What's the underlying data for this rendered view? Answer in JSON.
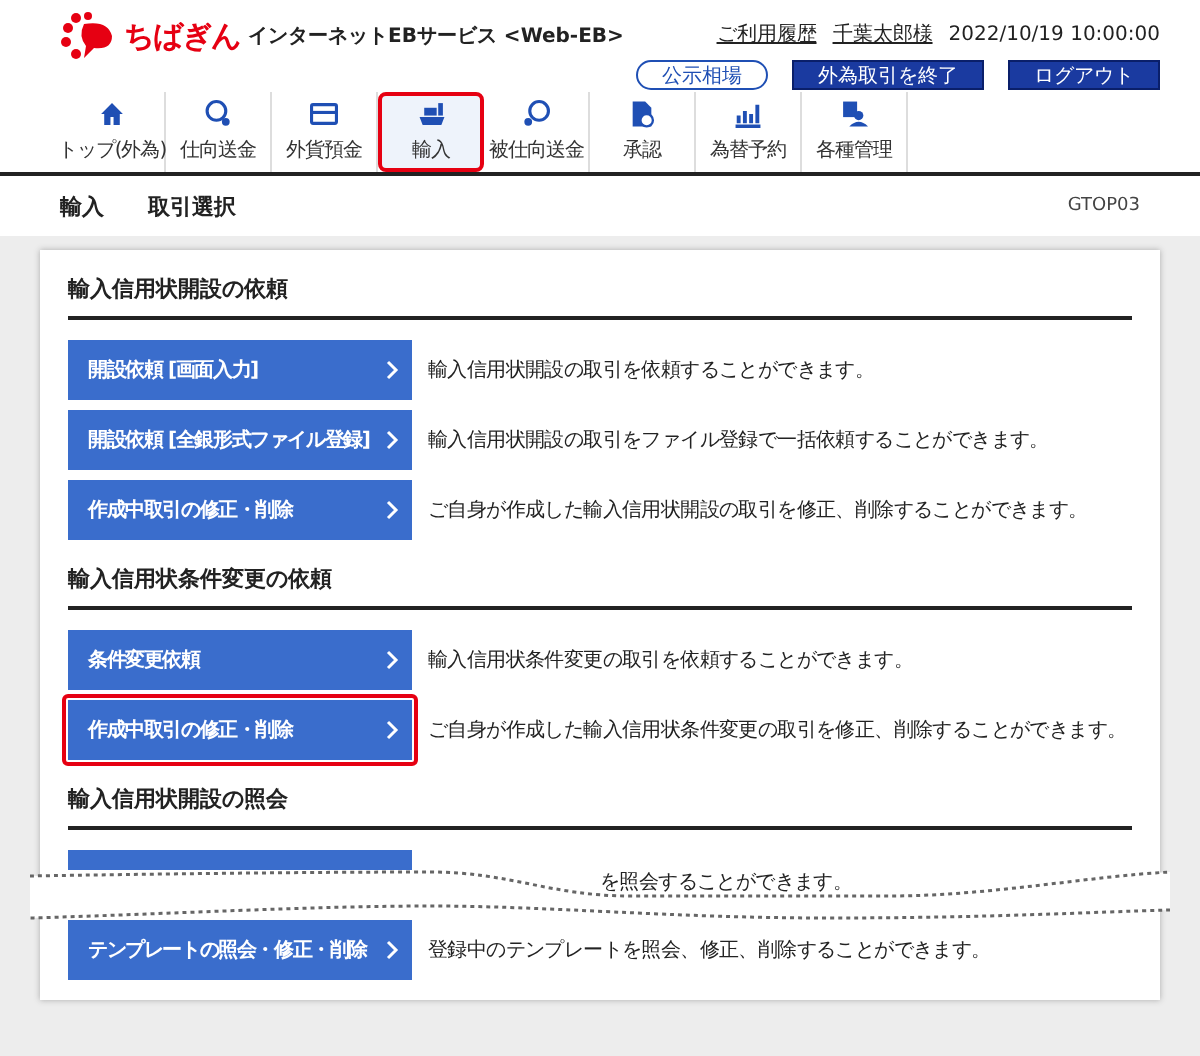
{
  "header": {
    "brand": "ちばぎん",
    "service": "インターネットEBサービス <Web-EB>",
    "links": [
      "ご利用履歴",
      "千葉太郎様"
    ],
    "timestamp": "2022/10/19 10:00:00",
    "buttons": [
      {
        "label": "公示相場",
        "kind": "outline"
      },
      {
        "label": "外為取引を終了",
        "kind": "solid"
      },
      {
        "label": "ログアウト",
        "kind": "solid"
      }
    ]
  },
  "nav": [
    {
      "label": "トップ(外為)",
      "selected": false
    },
    {
      "label": "仕向送金",
      "selected": false
    },
    {
      "label": "外貨預金",
      "selected": false
    },
    {
      "label": "輸入",
      "selected": true
    },
    {
      "label": "被仕向送金",
      "selected": false
    },
    {
      "label": "承認",
      "selected": false
    },
    {
      "label": "為替予約",
      "selected": false
    },
    {
      "label": "各種管理",
      "selected": false
    }
  ],
  "breadcrumb": [
    "輸入",
    "取引選択"
  ],
  "screen_id": "GTOP03",
  "sections": [
    {
      "title": "輸入信用状開設の依頼",
      "rows": [
        {
          "label": "開設依頼 [画面入力]",
          "description": "輸入信用状開設の取引を依頼することができます。",
          "highlighted": false
        },
        {
          "label": "開設依頼 [全銀形式ファイル登録]",
          "description": "輸入信用状開設の取引をファイル登録で一括依頼することができます。",
          "highlighted": false
        },
        {
          "label": "作成中取引の修正・削除",
          "description": "ご自身が作成した輸入信用状開設の取引を修正、削除することができます。",
          "highlighted": false
        }
      ]
    },
    {
      "title": "輸入信用状条件変更の依頼",
      "rows": [
        {
          "label": "条件変更依頼",
          "description": "輸入信用状条件変更の取引を依頼することができます。",
          "highlighted": false
        },
        {
          "label": "作成中取引の修正・削除",
          "description": "ご自身が作成した輸入信用状条件変更の取引を修正、削除することができます。",
          "highlighted": true
        }
      ]
    },
    {
      "title": "輸入信用状開設の照会",
      "rows": [
        {
          "description": "を照会することができます。",
          "highlighted": false,
          "torn": true
        },
        {
          "label": "テンプレートの照会・修正・削除",
          "description": "登録中のテンプレートを照会、修正、削除することができます。",
          "highlighted": false
        }
      ]
    }
  ]
}
